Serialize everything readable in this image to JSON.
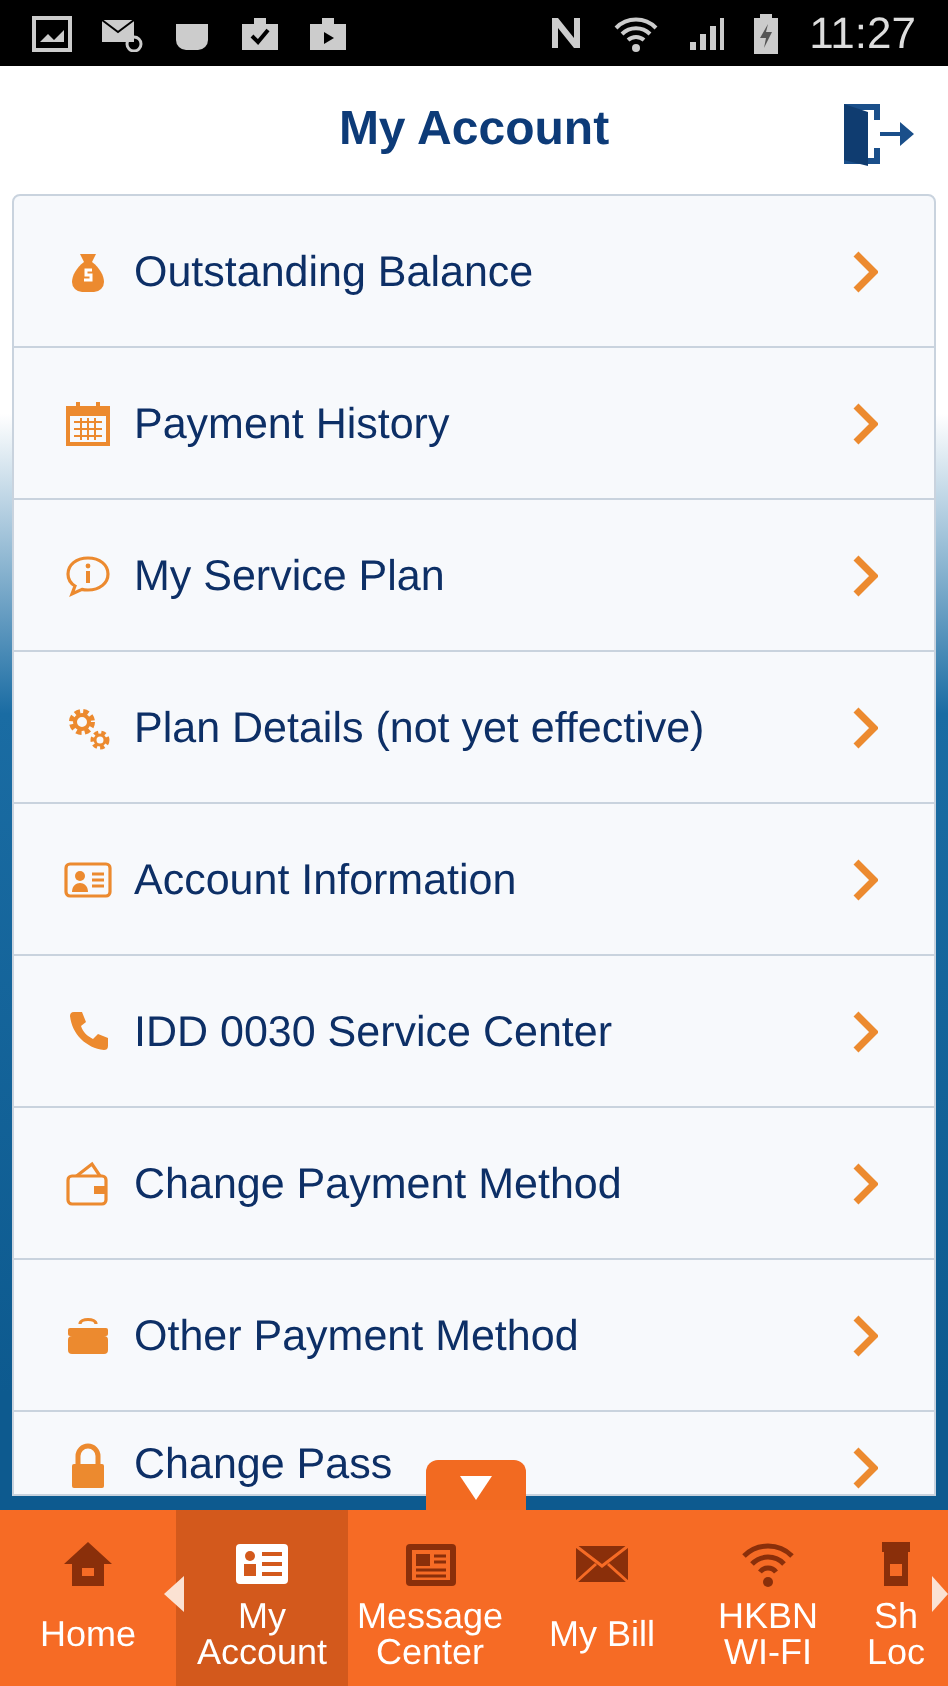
{
  "status_bar": {
    "time": "11:27"
  },
  "header": {
    "title": "My Account"
  },
  "menu": [
    {
      "label": "Outstanding Balance"
    },
    {
      "label": "Payment History"
    },
    {
      "label": "My Service Plan"
    },
    {
      "label": "Plan Details (not yet effective)"
    },
    {
      "label": "Account Information"
    },
    {
      "label": "IDD 0030 Service Center"
    },
    {
      "label": "Change Payment Method"
    },
    {
      "label": "Other Payment Method"
    },
    {
      "label": "Change Pass"
    }
  ],
  "bottom_nav": [
    {
      "label": "Home",
      "selected": false
    },
    {
      "label": "My Account",
      "selected": true
    },
    {
      "label": "Message Center",
      "selected": false
    },
    {
      "label": "My Bill",
      "selected": false
    },
    {
      "label": "HKBN WI-FI",
      "selected": false
    },
    {
      "label": "Sh Loc",
      "selected": false
    }
  ]
}
